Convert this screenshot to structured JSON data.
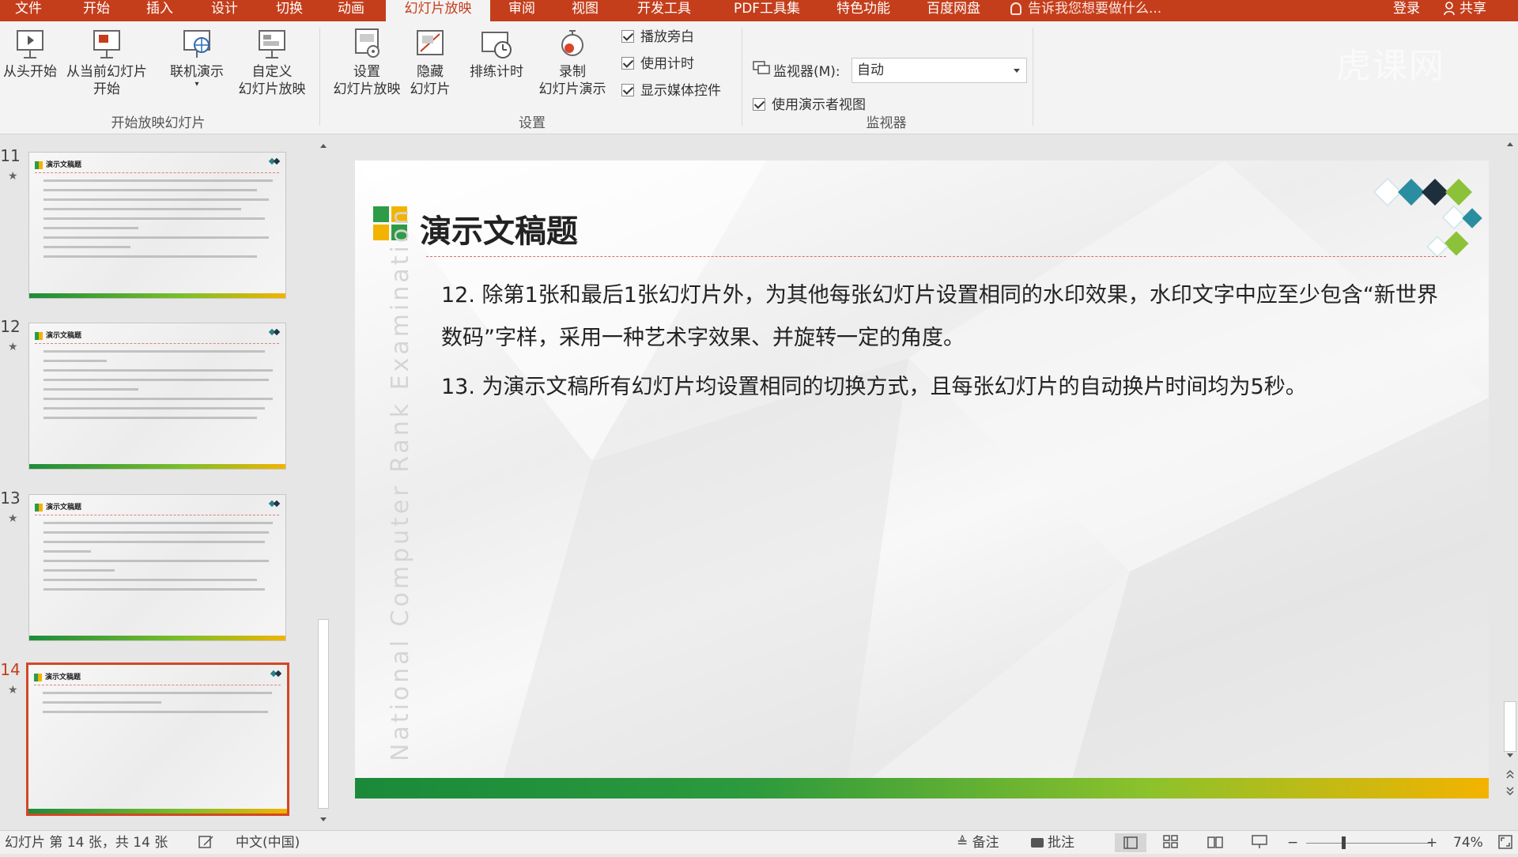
{
  "tabs": [
    "文件",
    "开始",
    "插入",
    "设计",
    "切换",
    "动画",
    "幻灯片放映",
    "审阅",
    "视图",
    "开发工具",
    "PDF工具集",
    "特色功能",
    "百度网盘"
  ],
  "tell_me": "告诉我您想要做什么...",
  "login": "登录",
  "share": "共享",
  "brand_watermark": "虎课网",
  "ribbon": {
    "btn_from_start": "从头开始",
    "btn_from_current_1": "从当前幻灯片",
    "btn_from_current_2": "开始",
    "btn_online_1": "联机演示",
    "btn_custom_1": "自定义",
    "btn_custom_2": "幻灯片放映",
    "group_start": "开始放映幻灯片",
    "btn_setup_1": "设置",
    "btn_setup_2": "幻灯片放映",
    "btn_hide_1": "隐藏",
    "btn_hide_2": "幻灯片",
    "btn_rehearse": "排练计时",
    "btn_record_1": "录制",
    "btn_record_2": "幻灯片演示",
    "chk_narration": "播放旁白",
    "chk_timing": "使用计时",
    "chk_media": "显示媒体控件",
    "group_setup": "设置",
    "monitor_label": "监视器(M):",
    "monitor_value": "自动",
    "chk_presenter": "使用演示者视图",
    "group_monitor": "监视器"
  },
  "thumbnails": [
    {
      "num": "11",
      "title": "演示文稿题"
    },
    {
      "num": "12",
      "title": "演示文稿题"
    },
    {
      "num": "13",
      "title": "演示文稿题"
    },
    {
      "num": "14",
      "title": "演示文稿题"
    }
  ],
  "slide": {
    "title": "演示文稿题",
    "watermark": "National Computer Rank Examination",
    "items": [
      "12. 除第1张和最后1张幻灯片外，为其他每张幻灯片设置相同的水印效果，水印文字中应至少包含“新世界数码”字样，采用一种艺术字效果、并旋转一定的角度。",
      "13. 为演示文稿所有幻灯片均设置相同的切换方式，且每张幻灯片的自动换片时间均为5秒。"
    ]
  },
  "status": {
    "slide_info": "幻灯片 第 14 张，共 14 张",
    "language": "中文(中国)",
    "notes": "备注",
    "comments": "批注",
    "zoom": "74%",
    "zoom_fraction": 0.3
  },
  "colors": {
    "accent": "#c43e1c",
    "green": "#2e9b47",
    "yellow": "#f2b400"
  }
}
